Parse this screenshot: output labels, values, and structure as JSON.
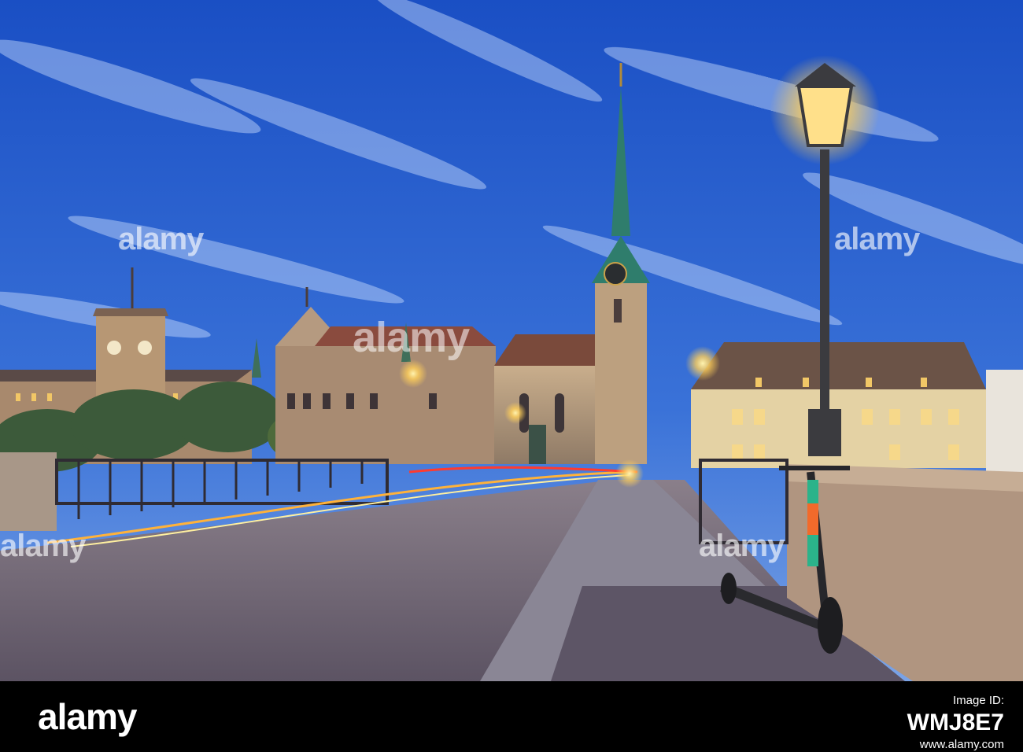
{
  "photo": {
    "subject": "",
    "colors": {
      "sky_top": "#1f54c7",
      "sky_bottom": "#5b8ee0",
      "spire": "#2f7d6c",
      "stone": "#b49a7b",
      "lamp_glow": "#ffd66b",
      "road": "#6b6170"
    }
  },
  "watermarks": {
    "center": "alamy",
    "top_left": "alamy",
    "top_right": "alamy",
    "bottom_left": "alamy",
    "bottom_right": "alamy"
  },
  "footer": {
    "logo": "alamy",
    "image_id_label": "Image ID:",
    "image_id": "WMJ8E7",
    "url": "www.alamy.com"
  }
}
